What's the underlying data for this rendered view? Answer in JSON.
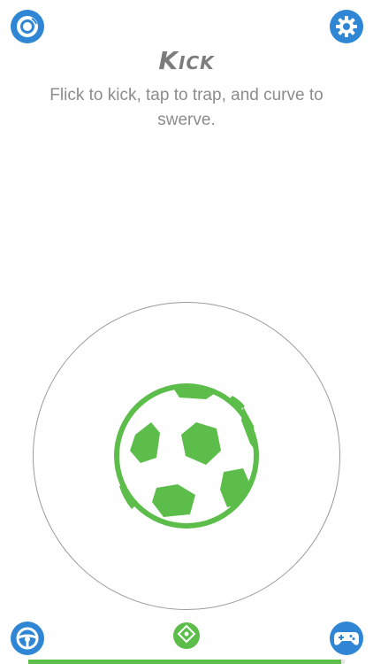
{
  "header": {
    "title": "Kick",
    "subtitle": "Flick to kick, tap to trap, and curve to swerve."
  },
  "icons": {
    "top_left": "robot-signal-icon",
    "top_right": "gear-icon",
    "bottom_left": "steering-wheel-icon",
    "bottom_center": "direction-pad-icon",
    "bottom_right": "gamepad-icon",
    "center": "soccer-ball-icon"
  },
  "progress": {
    "fraction": 0.99
  },
  "colors": {
    "accent_blue": "#2f86d4",
    "accent_green": "#5cbd4a",
    "text_gray": "#8c8c8c"
  }
}
